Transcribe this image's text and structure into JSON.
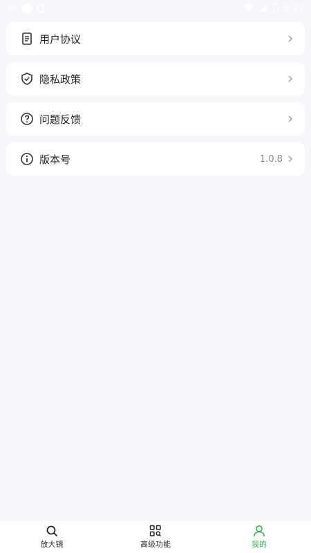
{
  "status_bar": {
    "left_text": "7G",
    "time": "3:19"
  },
  "menu": {
    "items": [
      {
        "icon": "document-icon",
        "label": "用户协议",
        "value": ""
      },
      {
        "icon": "shield-check-icon",
        "label": "隐私政策",
        "value": ""
      },
      {
        "icon": "question-circle-icon",
        "label": "问题反馈",
        "value": ""
      },
      {
        "icon": "info-circle-icon",
        "label": "版本号",
        "value": "1.0.8"
      }
    ]
  },
  "bottom_nav": {
    "items": [
      {
        "icon": "search-icon",
        "label": "放大镜",
        "active": false
      },
      {
        "icon": "grid-search-icon",
        "label": "高级功能",
        "active": false
      },
      {
        "icon": "user-icon",
        "label": "我的",
        "active": true
      }
    ]
  },
  "colors": {
    "accent": "#2db84a",
    "background": "#f6f7fb",
    "card": "#ffffff",
    "text": "#222222",
    "muted": "#8a8a8a"
  }
}
